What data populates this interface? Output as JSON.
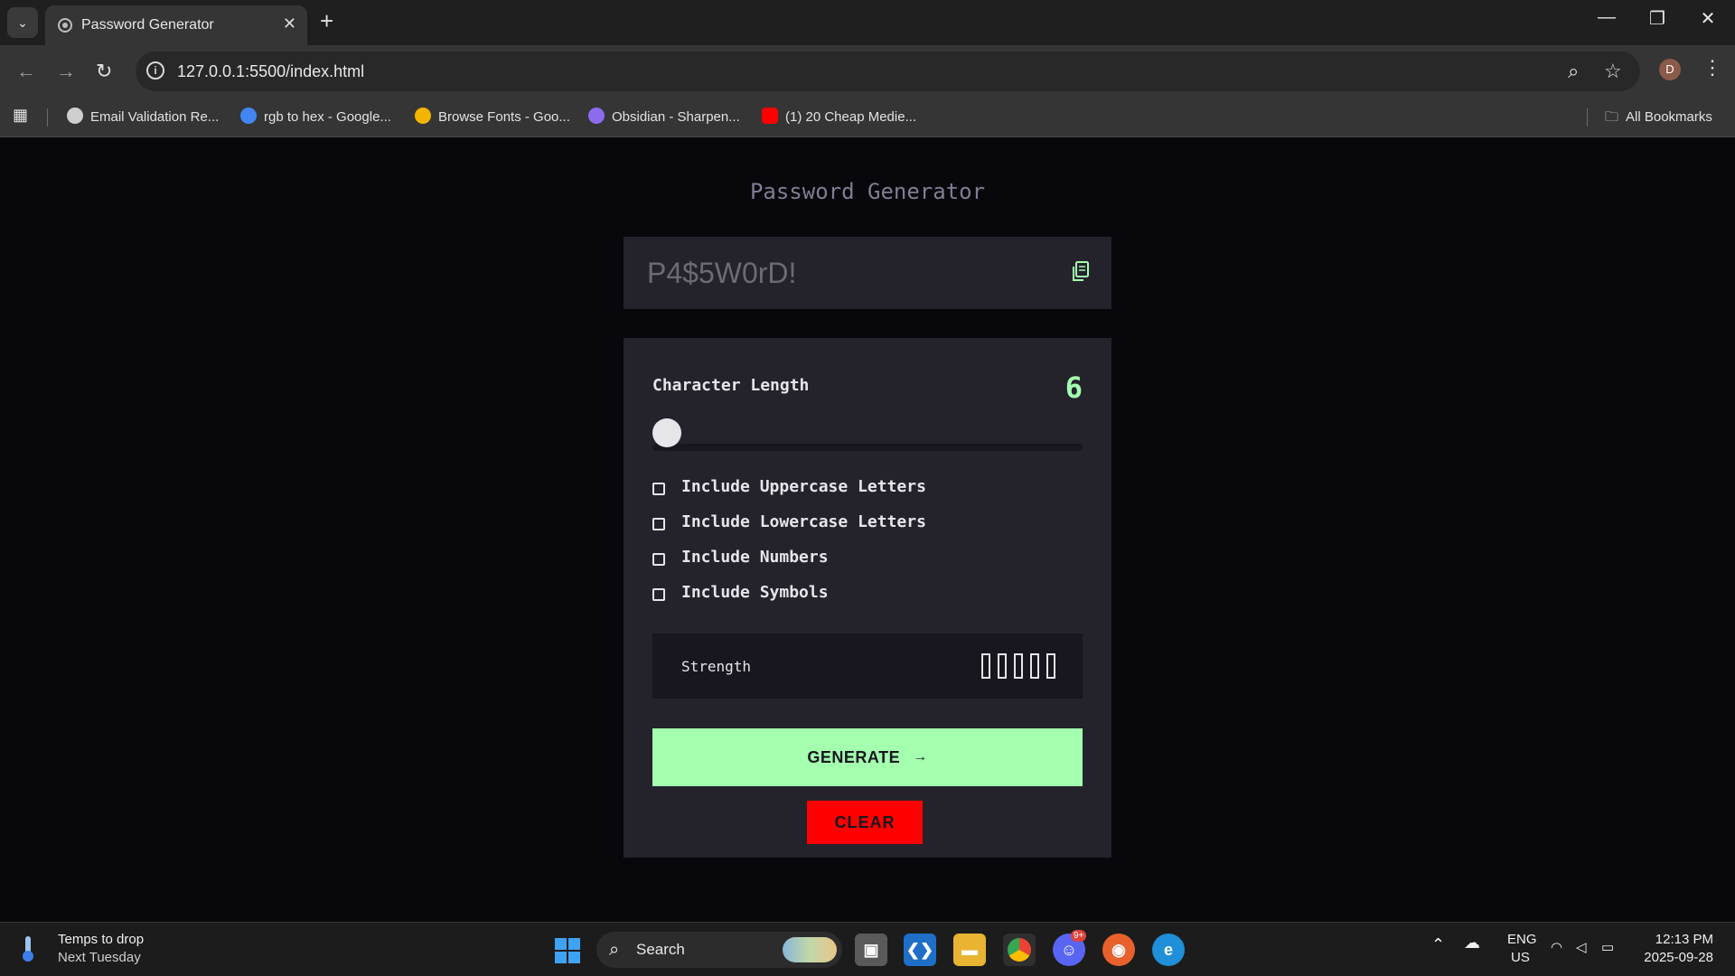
{
  "browser": {
    "tab_title": "Password Generator",
    "url": "127.0.0.1:5500/index.html",
    "bookmarks": [
      {
        "label": "Email Validation Re...",
        "color": "#cfcfcf"
      },
      {
        "label": "rgb to hex - Google...",
        "color": "#4285f4"
      },
      {
        "label": "Browse Fonts - Goo...",
        "color": "#f4b400"
      },
      {
        "label": "Obsidian - Sharpen...",
        "color": "#8b6cef"
      },
      {
        "label": "(1) 20 Cheap Medie...",
        "color": "#ff0000"
      }
    ],
    "all_bookmarks": "All Bookmarks",
    "profile_initial": "D"
  },
  "app": {
    "title": "Password Generator",
    "password_placeholder": "P4$5W0rD!",
    "length_label": "Character Length",
    "length_value": "6",
    "length_slider_fraction": 0,
    "options": [
      {
        "label": "Include Uppercase Letters",
        "checked": false
      },
      {
        "label": "Include Lowercase Letters",
        "checked": false
      },
      {
        "label": "Include Numbers",
        "checked": false
      },
      {
        "label": "Include Symbols",
        "checked": false
      }
    ],
    "strength_label": "Strength",
    "strength_bars_filled": 0,
    "generate_label": "GENERATE",
    "clear_label": "CLEAR",
    "colors": {
      "accent": "#a4ffaf",
      "clear": "#fe0000",
      "panel": "#24232c",
      "background": "#08070b"
    }
  },
  "taskbar": {
    "weather_line1": "Temps to drop",
    "weather_line2": "Next Tuesday",
    "search_label": "Search",
    "badge": "9+",
    "lang_line1": "ENG",
    "lang_line2": "US",
    "time": "12:13 PM",
    "date": "2025-09-28"
  }
}
